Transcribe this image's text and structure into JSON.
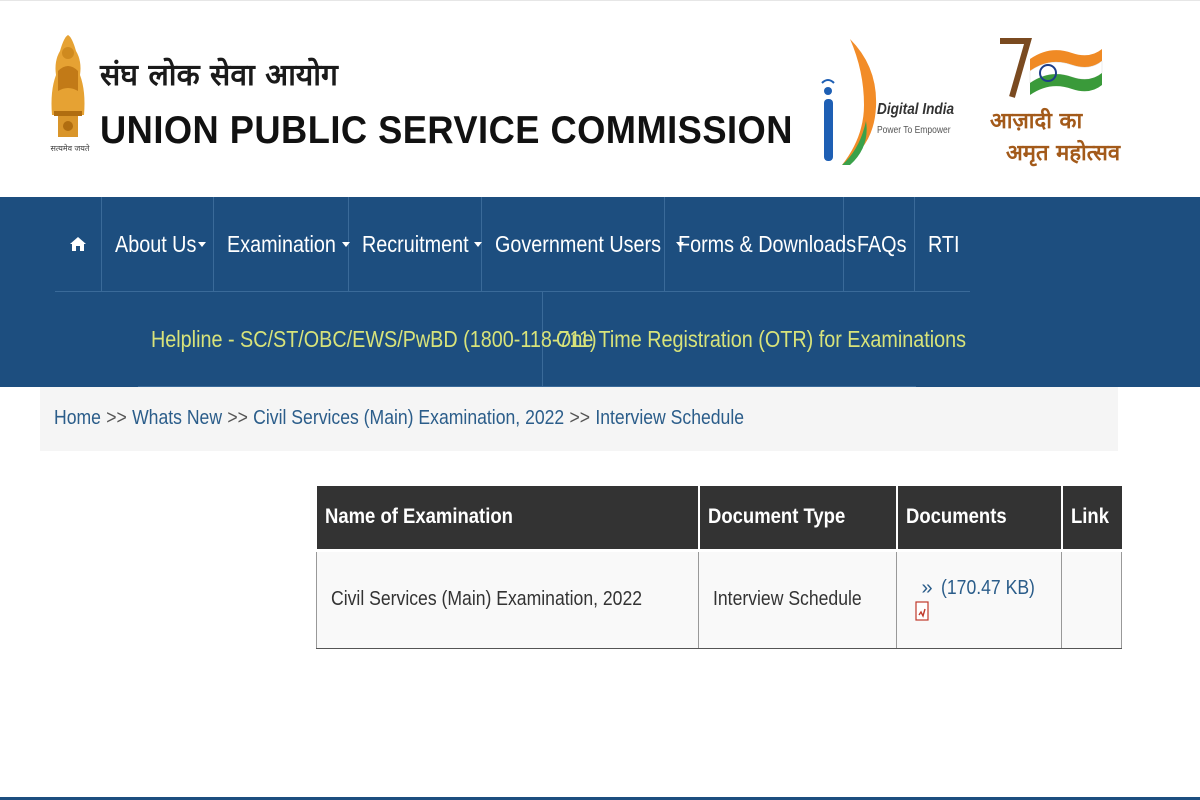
{
  "header": {
    "org_name_hindi": "संघ लोक सेवा आयोग",
    "org_name_english": "UNION PUBLIC SERVICE COMMISSION",
    "emblem_motto": "सत्यमेव जयते",
    "digital_india": {
      "title": "Digital India",
      "tagline": "Power To Empower"
    },
    "azadi": {
      "line1": "आज़ादी का",
      "line2": "अमृत महोत्सव"
    }
  },
  "nav": {
    "home_icon": "home-icon",
    "items": [
      {
        "label": "About Us",
        "dropdown": true
      },
      {
        "label": "Examination",
        "dropdown": true
      },
      {
        "label": "Recruitment",
        "dropdown": true
      },
      {
        "label": "Government Users",
        "dropdown": true
      },
      {
        "label": "Forms & Downloads",
        "dropdown": false
      },
      {
        "label": "FAQs",
        "dropdown": false
      },
      {
        "label": "RTI",
        "dropdown": false
      }
    ],
    "secondary": [
      {
        "label": "Helpline - SC/ST/OBC/EWS/PwBD (1800-118-711)"
      },
      {
        "label": "One Time Registration (OTR) for Examinations"
      }
    ]
  },
  "breadcrumb": {
    "items": [
      "Home",
      "Whats New",
      "Civil Services (Main) Examination, 2022",
      "Interview Schedule"
    ],
    "separator": ">>"
  },
  "table": {
    "headers": [
      "Name of Examination",
      "Document Type",
      "Documents",
      "Link"
    ],
    "rows": [
      {
        "exam": "Civil Services (Main) Examination, 2022",
        "doc_type": "Interview Schedule",
        "doc_marker": "»",
        "doc_size": "(170.47 KB)",
        "link": ""
      }
    ]
  },
  "colors": {
    "nav_bg": "#1d4e7f",
    "helpline_text": "#d8e37a",
    "link_blue": "#2b5d8a",
    "table_header_bg": "#333333"
  }
}
